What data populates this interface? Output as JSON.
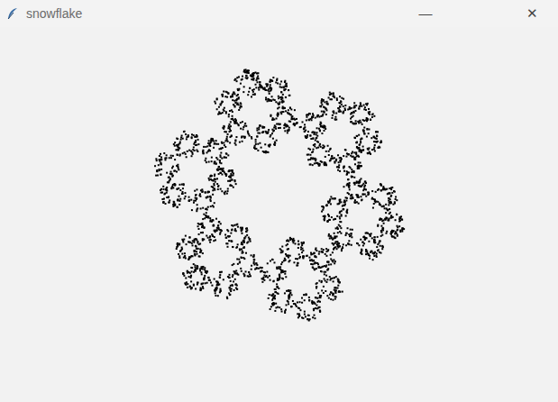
{
  "window": {
    "title": "snowflake",
    "controls": [
      {
        "name": "minimize",
        "label": "—"
      },
      {
        "name": "close",
        "label": "✕"
      }
    ]
  }
}
